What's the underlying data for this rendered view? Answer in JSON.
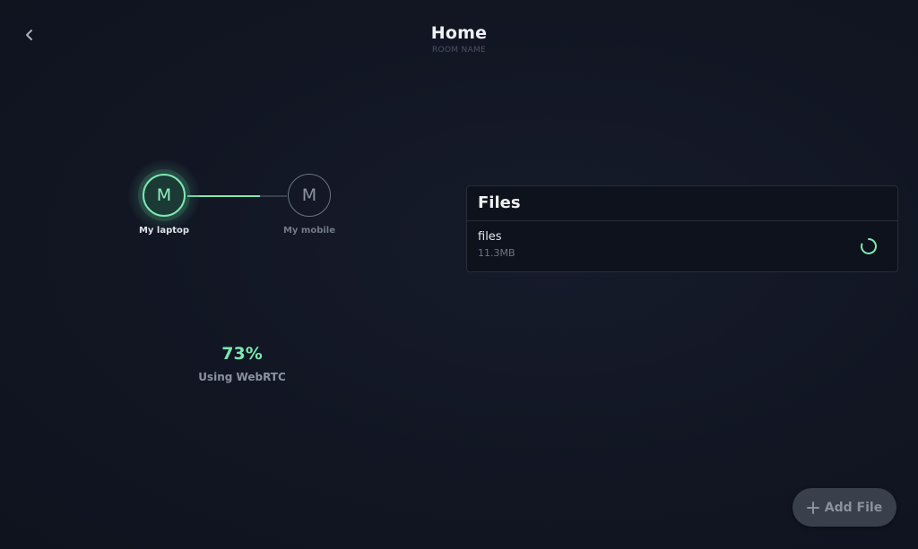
{
  "header": {
    "title": "Home",
    "subtitle": "ROOM NAME",
    "back_icon": "chevron-left-icon"
  },
  "peers": [
    {
      "initial": "M",
      "label": "My laptop",
      "is_self": true
    },
    {
      "initial": "M",
      "label": "My mobile",
      "is_self": false
    }
  ],
  "transfer": {
    "progress": 0.73,
    "progress_label": "73%",
    "transport_label": "Using WebRTC"
  },
  "files_panel": {
    "title": "Files",
    "items": [
      {
        "name": "files",
        "size": "11.3MB",
        "status_icon": "loading-spinner-icon"
      }
    ]
  },
  "actions": {
    "add_file_label": "Add File",
    "add_file_icon": "plus-icon"
  },
  "colors": {
    "background": "#121623",
    "accent": "#7de8b0",
    "muted": "#8b92a2",
    "panel": "#0e121c"
  }
}
